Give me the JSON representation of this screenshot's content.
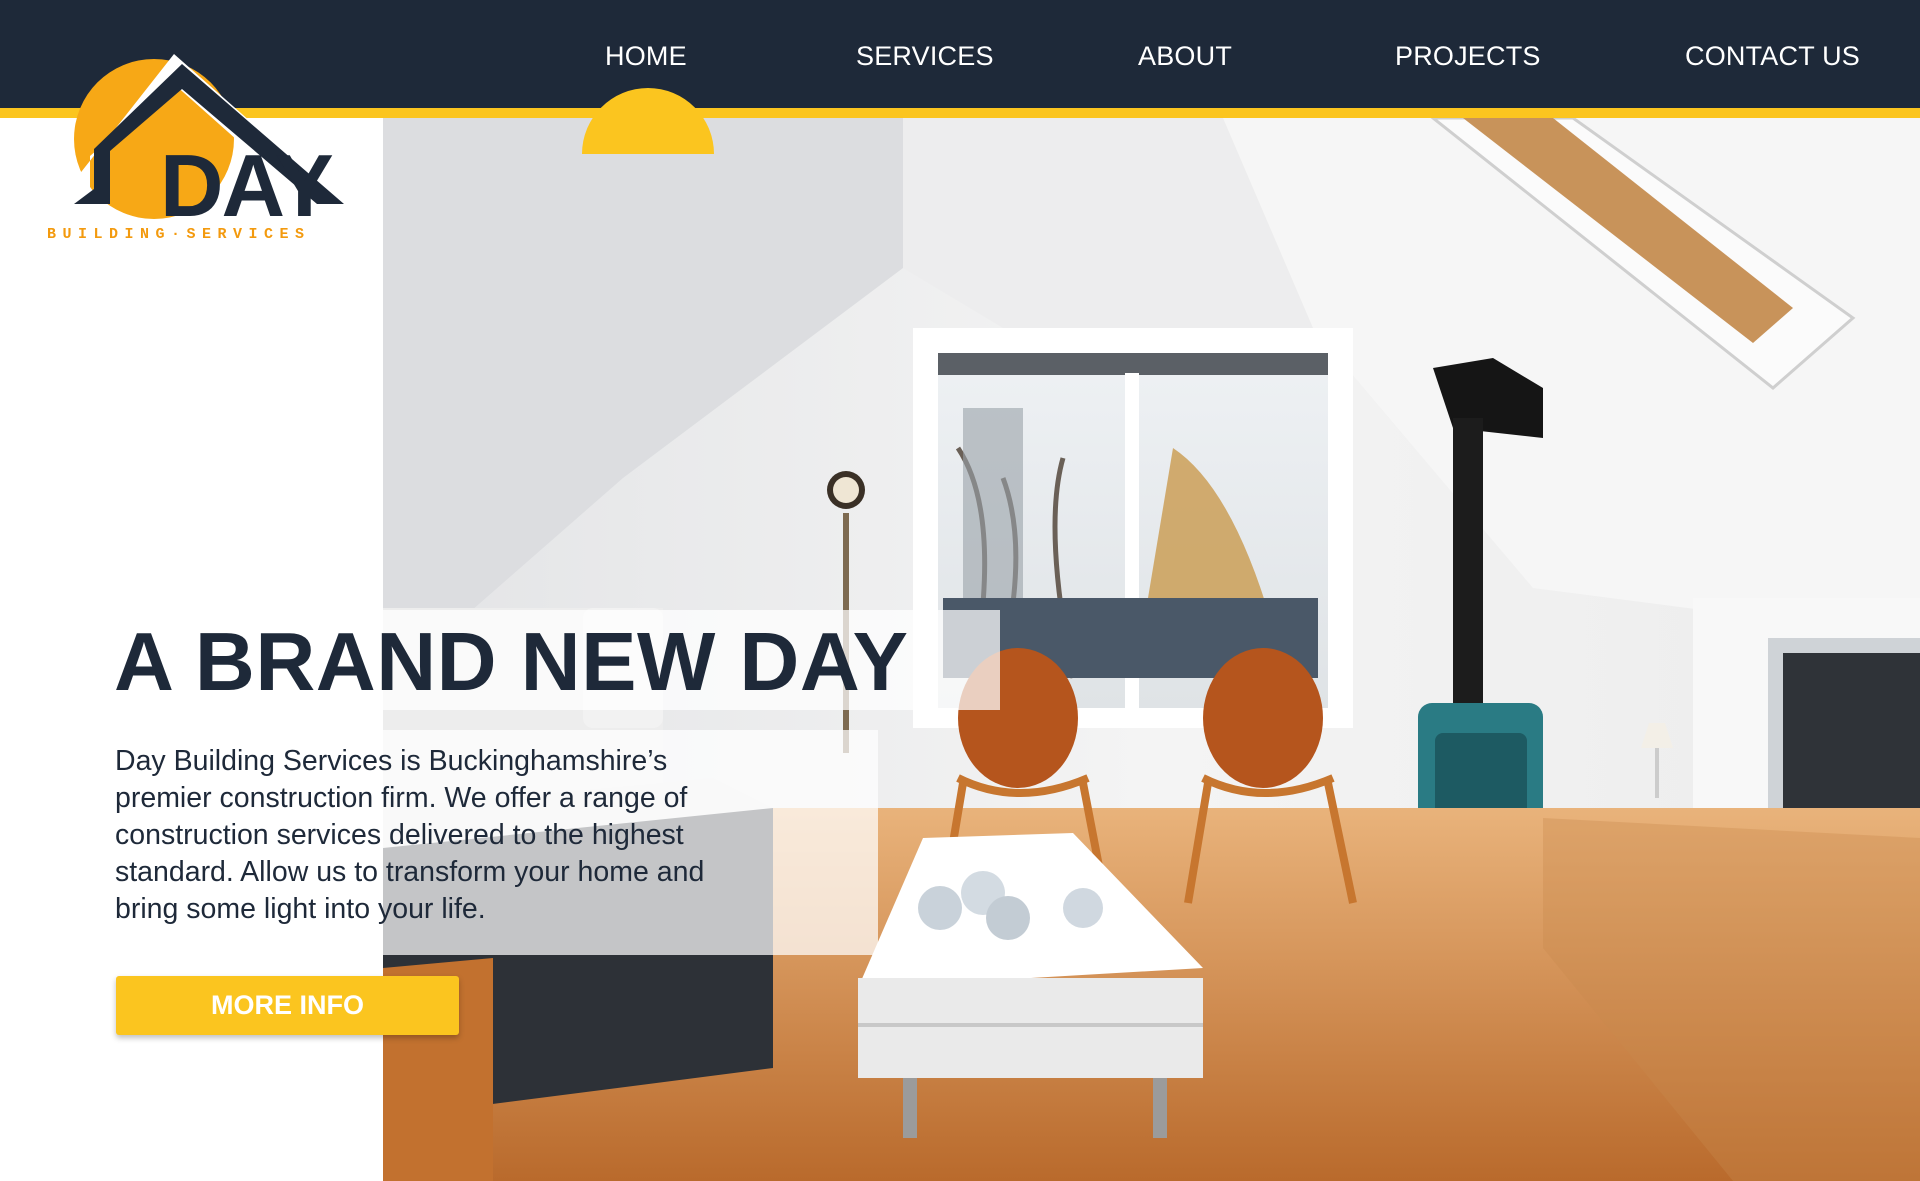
{
  "brand": {
    "logo_word": "DAY",
    "tagline": "BUILDING·SERVICES",
    "colors": {
      "navy": "#1e2939",
      "accent": "#fbc51f",
      "sun": "#f7a816",
      "tagline": "#f39a0e"
    }
  },
  "nav": {
    "items": [
      {
        "label": "HOME",
        "active": true
      },
      {
        "label": "SERVICES",
        "active": false
      },
      {
        "label": "ABOUT",
        "active": false
      },
      {
        "label": "PROJECTS",
        "active": false
      },
      {
        "label": "CONTACT US",
        "active": false
      }
    ]
  },
  "hero": {
    "headline": "A BRAND NEW DAY",
    "body_lines": [
      "Day Building Services is Buckinghamshire’s",
      "premier construction firm. We offer a range of",
      "construction services delivered to the highest",
      "standard. Allow us to transform your home and",
      "bring some light into your life."
    ],
    "cta_label": "MORE INFO"
  }
}
